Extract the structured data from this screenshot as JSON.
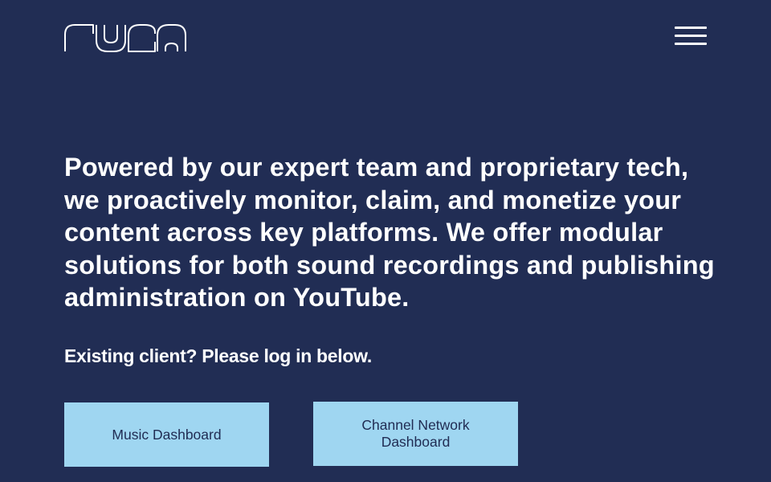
{
  "brand": {
    "logo_text": "FUGA",
    "logo_icon": "fuga-logo"
  },
  "header": {
    "menu_icon": "hamburger-menu-icon"
  },
  "hero": {
    "headline": "Powered by our expert team and proprietary tech, we proactively monitor, claim, and monetize your content across key platforms. We offer modular solutions for both sound recordings and publishing administration on YouTube.",
    "subline": "Existing client? Please log in below."
  },
  "actions": {
    "music_dashboard_label": "Music Dashboard",
    "channel_network_dashboard_label": "Channel Network Dashboard"
  },
  "colors": {
    "background": "#212d54",
    "text": "#ffffff",
    "button_background": "#9fd6f1",
    "button_text": "#212d54"
  }
}
